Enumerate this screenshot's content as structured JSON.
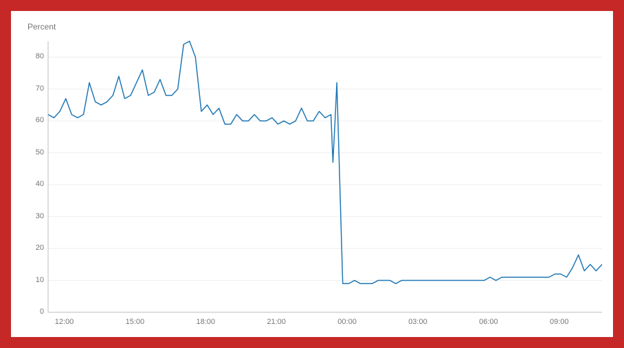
{
  "chart_data": {
    "type": "line",
    "ylabel": "Percent",
    "xlabel": "",
    "ylim": [
      0,
      85
    ],
    "yticks": [
      0,
      10,
      20,
      30,
      40,
      50,
      60,
      70,
      80
    ],
    "xticks": [
      "12:00",
      "15:00",
      "18:00",
      "21:00",
      "00:00",
      "03:00",
      "06:00",
      "09:00"
    ],
    "x": [
      "11:15",
      "11:30",
      "11:45",
      "12:00",
      "12:15",
      "12:30",
      "12:45",
      "13:00",
      "13:15",
      "13:30",
      "13:45",
      "14:00",
      "14:15",
      "14:30",
      "14:45",
      "15:00",
      "15:15",
      "15:30",
      "15:45",
      "16:00",
      "16:15",
      "16:30",
      "16:45",
      "17:00",
      "17:15",
      "17:30",
      "17:45",
      "18:00",
      "18:15",
      "18:30",
      "18:45",
      "19:00",
      "19:15",
      "19:30",
      "19:45",
      "20:00",
      "20:15",
      "20:30",
      "20:45",
      "21:00",
      "21:15",
      "21:30",
      "21:45",
      "22:00",
      "22:15",
      "22:30",
      "22:45",
      "23:00",
      "23:15",
      "23:20",
      "23:25",
      "23:30",
      "23:45",
      "00:00",
      "00:15",
      "00:30",
      "00:45",
      "01:00",
      "01:15",
      "01:30",
      "01:45",
      "02:00",
      "02:15",
      "02:30",
      "02:45",
      "03:00",
      "03:15",
      "03:30",
      "03:45",
      "04:00",
      "04:15",
      "04:30",
      "04:45",
      "05:00",
      "05:15",
      "05:30",
      "05:45",
      "06:00",
      "06:15",
      "06:30",
      "06:45",
      "07:00",
      "07:15",
      "07:30",
      "07:45",
      "08:00",
      "08:15",
      "08:30",
      "08:45",
      "09:00",
      "09:15",
      "09:30",
      "09:45",
      "10:00",
      "10:15",
      "10:30",
      "10:45"
    ],
    "values": [
      62,
      61,
      63,
      67,
      62,
      61,
      62,
      72,
      66,
      65,
      66,
      68,
      74,
      67,
      68,
      72,
      76,
      68,
      69,
      73,
      68,
      68,
      70,
      84,
      85,
      80,
      63,
      65,
      62,
      64,
      59,
      59,
      62,
      60,
      60,
      62,
      60,
      60,
      61,
      59,
      60,
      59,
      60,
      64,
      60,
      60,
      63,
      61,
      62,
      47,
      59,
      72,
      9,
      9,
      10,
      9,
      9,
      9,
      10,
      10,
      10,
      9,
      10,
      10,
      10,
      10,
      10,
      10,
      10,
      10,
      10,
      10,
      10,
      10,
      10,
      10,
      10,
      11,
      10,
      11,
      11,
      11,
      11,
      11,
      11,
      11,
      11,
      11,
      12,
      12,
      11,
      14,
      18,
      13,
      15,
      13,
      15
    ]
  }
}
